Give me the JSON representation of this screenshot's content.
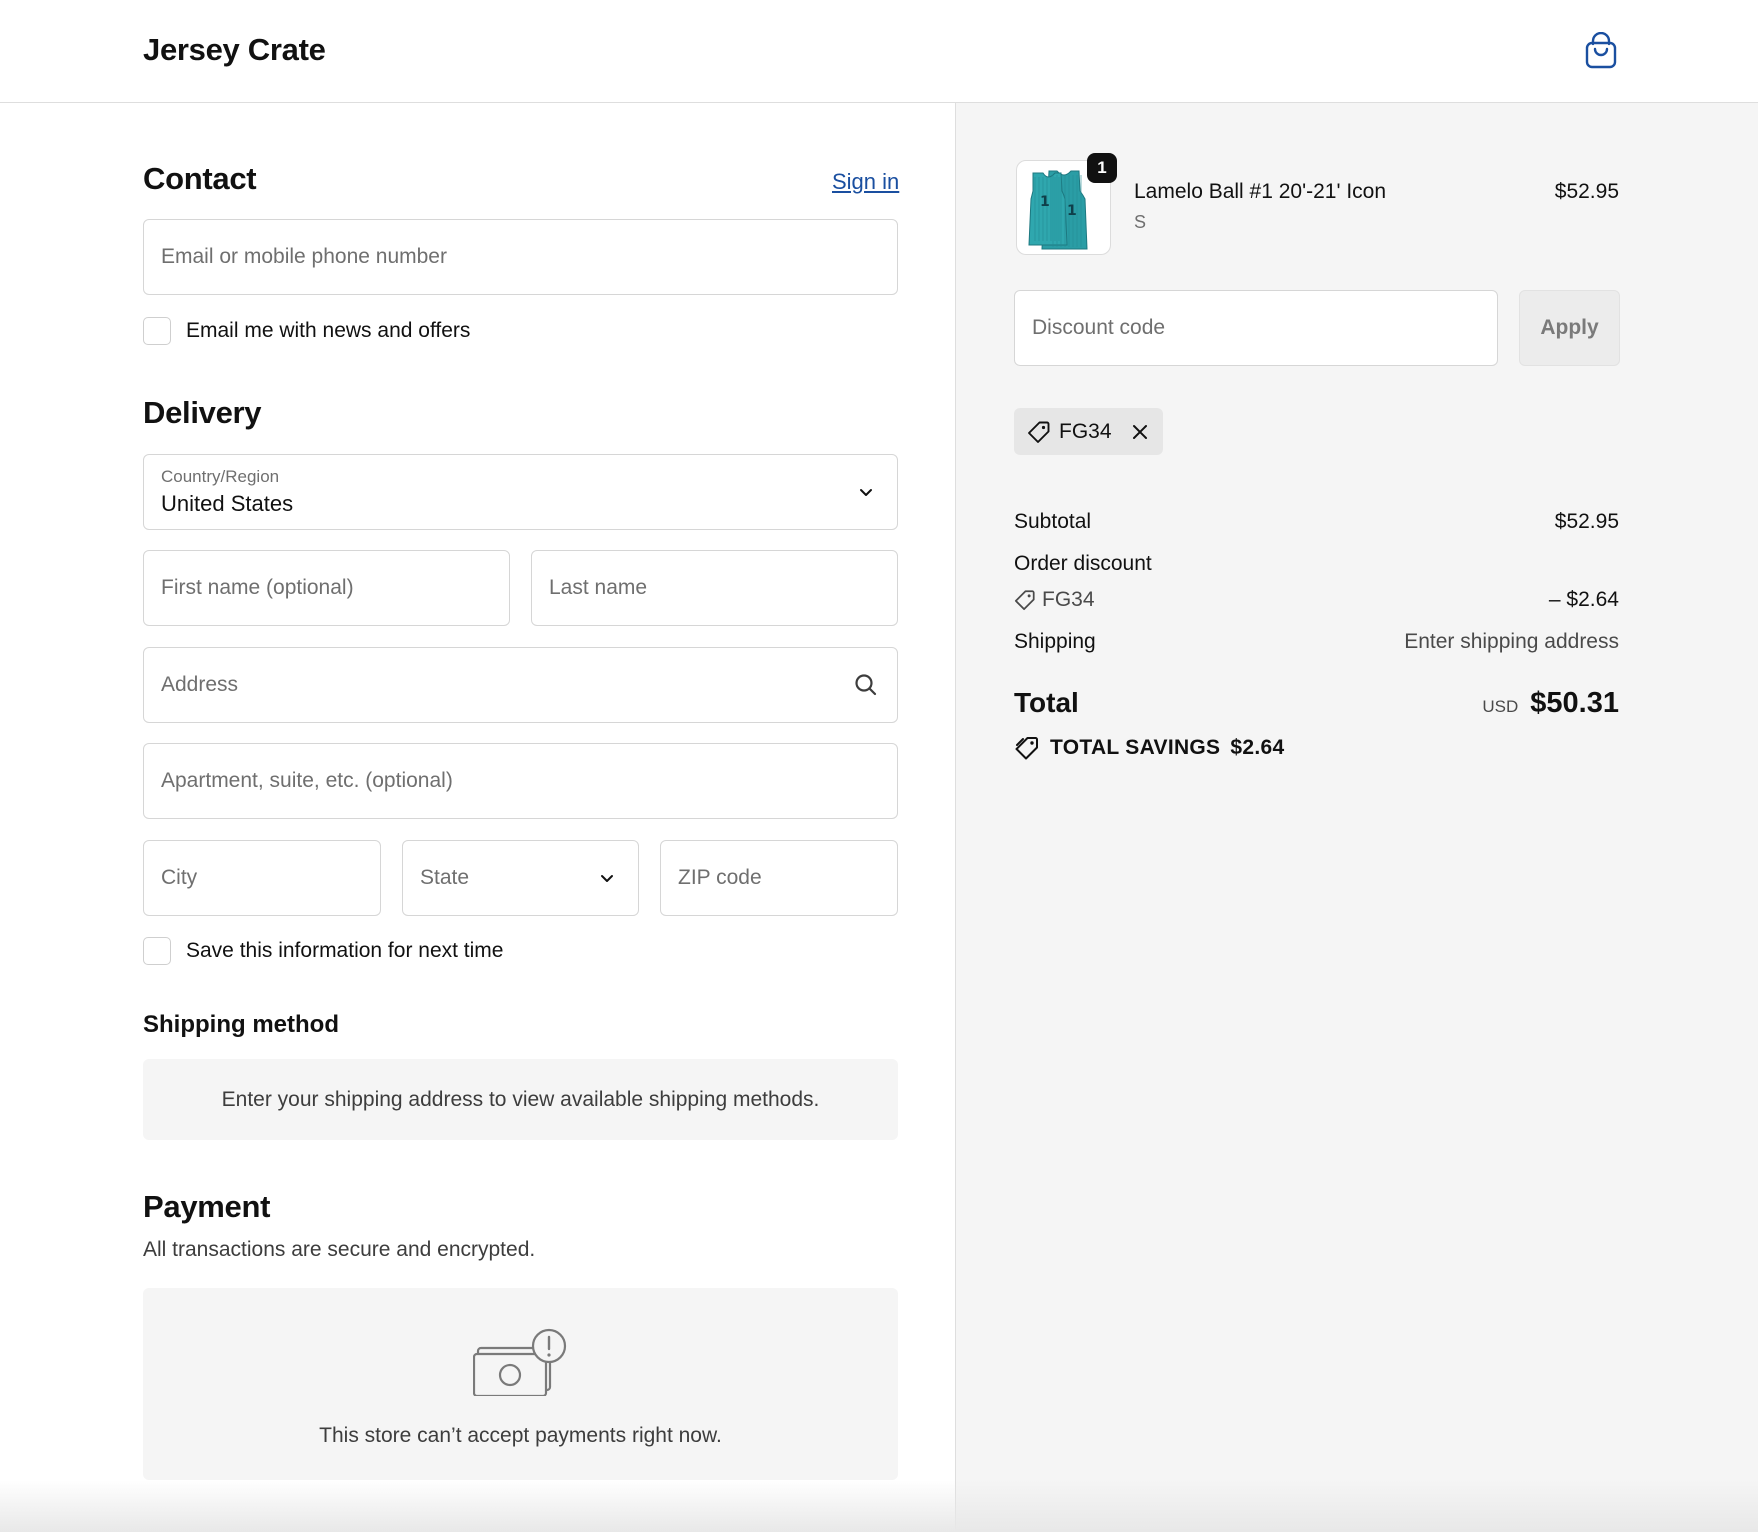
{
  "header": {
    "brand": "Jersey Crate",
    "cart_icon": "shopping-bag-icon"
  },
  "contact": {
    "title": "Contact",
    "sign_in": "Sign in",
    "email_placeholder": "Email or mobile phone number",
    "newsletter_label": "Email me with news and offers"
  },
  "delivery": {
    "title": "Delivery",
    "country_label": "Country/Region",
    "country_value": "United States",
    "first_name_placeholder": "First name (optional)",
    "last_name_placeholder": "Last name",
    "address_placeholder": "Address",
    "apartment_placeholder": "Apartment, suite, etc. (optional)",
    "city_placeholder": "City",
    "state_placeholder": "State",
    "zip_placeholder": "ZIP code",
    "save_info_label": "Save this information for next time"
  },
  "shipping_method": {
    "title": "Shipping method",
    "message": "Enter your shipping address to view available shipping methods."
  },
  "payment": {
    "title": "Payment",
    "subtitle": "All transactions are secure and encrypted.",
    "message": "This store can’t accept payments right now."
  },
  "summary": {
    "item": {
      "quantity": "1",
      "name": "Lamelo Ball #1 20'-21' Icon",
      "variant": "S",
      "price": "$52.95"
    },
    "discount_placeholder": "Discount code",
    "apply_label": "Apply",
    "applied_code": "FG34",
    "subtotal_label": "Subtotal",
    "subtotal_value": "$52.95",
    "order_discount_label": "Order discount",
    "discount_code": "FG34",
    "discount_value": "– $2.64",
    "shipping_label": "Shipping",
    "shipping_value": "Enter shipping address",
    "total_label": "Total",
    "currency": "USD",
    "total_value": "$50.31",
    "savings_label": "TOTAL SAVINGS",
    "savings_value": "$2.64"
  },
  "colors": {
    "link": "#1a4fa0",
    "jersey": "#2a9da5",
    "summary_bg": "#f5f5f5"
  }
}
